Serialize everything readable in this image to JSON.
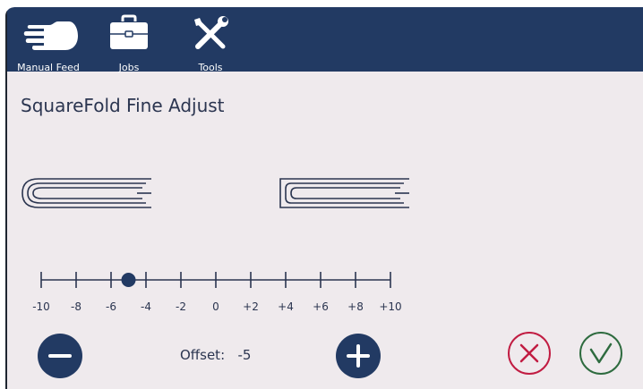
{
  "toolbar": {
    "items": [
      {
        "label": "Manual Feed",
        "icon": "hand-icon"
      },
      {
        "label": "Jobs",
        "icon": "briefcase-icon"
      },
      {
        "label": "Tools",
        "icon": "tools-icon"
      }
    ]
  },
  "page": {
    "title": "SquareFold Fine Adjust"
  },
  "scale": {
    "labels": [
      "-10",
      "-8",
      "-6",
      "-4",
      "-2",
      "0",
      "+2",
      "+4",
      "+6",
      "+8",
      "+10"
    ],
    "min": -10,
    "max": 10,
    "value": -5
  },
  "offset": {
    "label": "Offset:",
    "value": "-5"
  },
  "colors": {
    "navy": "#223a63",
    "background": "#efeaed",
    "cancel": "#c11c42",
    "confirm": "#2e6b3f"
  }
}
